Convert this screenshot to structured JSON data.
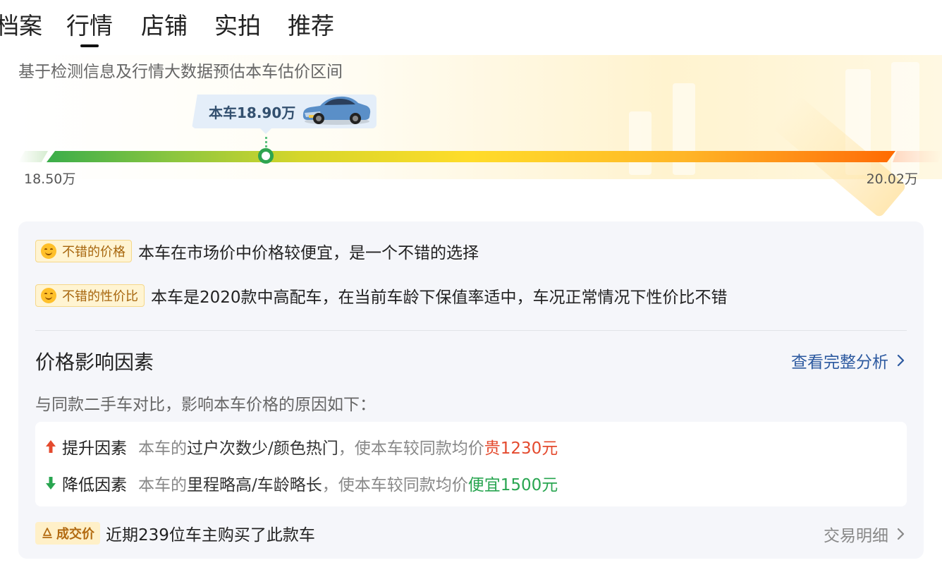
{
  "tabs": [
    {
      "label": "档案"
    },
    {
      "label": "行情",
      "active": true
    },
    {
      "label": "店铺"
    },
    {
      "label": "实拍"
    },
    {
      "label": "推荐"
    }
  ],
  "estimate": {
    "subtitle": "基于检测信息及行情大数据预估本车估价区间",
    "current_price_label": "本车18.90万",
    "range_min": "18.50万",
    "range_max": "20.02万",
    "current_position_fraction": 0.26
  },
  "verdicts": [
    {
      "badge": "不错的价格",
      "icon": "smiley-icon",
      "text": "本车在市场价中价格较便宜，是一个不错的选择"
    },
    {
      "badge": "不错的性价比",
      "icon": "smiley-icon",
      "text": "本车是2020款中高配车，在当前车龄下保值率适中，车况正常情况下性价比不错"
    }
  ],
  "factors": {
    "title": "价格影响因素",
    "link": "查看完整分析",
    "description": "与同款二手车对比，影响本车价格的原因如下：",
    "up": {
      "label": "提升因素",
      "prefix": "本车的",
      "reasons": "过户次数少/颜色热门",
      "middle": "，使本车较同款均价",
      "effect": "贵1230元"
    },
    "down": {
      "label": "降低因素",
      "prefix": "本车的",
      "reasons": "里程略高/车龄略长",
      "middle": "，使本车较同款均价",
      "effect": "便宜1500元"
    }
  },
  "deals": {
    "badge": "成交价",
    "text": "近期239位车主购买了此款车",
    "link": "交易明细"
  },
  "colors": {
    "accent_link": "#2d5aa0",
    "up_color": "#e44a2e",
    "down_color": "#28a550",
    "marker_green": "#2ea44f"
  }
}
